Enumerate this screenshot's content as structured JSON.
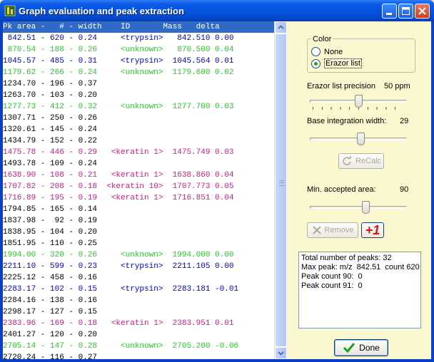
{
  "window": {
    "title": "Graph evaluation and peak extraction"
  },
  "list": {
    "header": "Pk area -   # - width    ID       Mass   delta",
    "rows": [
      {
        "text": " 842.51 - 620 - 0.24     <trypsin>   842.510 0.00",
        "color": "#0000cc"
      },
      {
        "text": " 870.54 - 188 - 0.26     <unknown>   870.500 0.04",
        "color": "#22cc22"
      },
      {
        "text": "1045.57 - 485 - 0.31     <trypsin>  1045.564 0.01",
        "color": "#0000cc"
      },
      {
        "text": "1179.62 - 266 - 0.24     <unknown>  1179.600 0.02",
        "color": "#22cc22"
      },
      {
        "text": "1234.70 - 196 - 0.37",
        "color": "#000000"
      },
      {
        "text": "1263.70 - 103 - 0.20",
        "color": "#000000"
      },
      {
        "text": "1277.73 - 412 - 0.32     <unknown>  1277.700 0.03",
        "color": "#22cc22"
      },
      {
        "text": "1307.71 - 250 - 0.26",
        "color": "#000000"
      },
      {
        "text": "1320.61 - 145 - 0.24",
        "color": "#000000"
      },
      {
        "text": "1434.79 - 152 - 0.22",
        "color": "#000000"
      },
      {
        "text": "1475.78 - 446 - 0.29   <keratin 1>  1475.749 0.03",
        "color": "#cc1a8c"
      },
      {
        "text": "1493.78 - 109 - 0.24",
        "color": "#000000"
      },
      {
        "text": "1638.90 - 108 - 0.21   <keratin 1>  1638.860 0.04",
        "color": "#cc1a8c"
      },
      {
        "text": "1707.82 - 208 - 0.18  <keratin 10>  1707.773 0.05",
        "color": "#cc1a8c"
      },
      {
        "text": "1716.89 - 195 - 0.19   <keratin 1>  1716.851 0.04",
        "color": "#cc1a8c"
      },
      {
        "text": "1794.85 - 165 - 0.14",
        "color": "#000000"
      },
      {
        "text": "1837.98 -  92 - 0.19",
        "color": "#000000"
      },
      {
        "text": "1838.95 - 104 - 0.20",
        "color": "#000000"
      },
      {
        "text": "1851.95 - 110 - 0.25",
        "color": "#000000"
      },
      {
        "text": "1994.00 - 320 - 0.26     <unknown>  1994.000 0.00",
        "color": "#22cc22"
      },
      {
        "text": "2211.10 - 599 - 0.23     <trypsin>  2211.105 0.00",
        "color": "#0000cc"
      },
      {
        "text": "2225.12 - 458 - 0.16",
        "color": "#000000"
      },
      {
        "text": "2283.17 - 102 - 0.15     <trypsin>  2283.181 -0.01",
        "color": "#0000cc"
      },
      {
        "text": "2284.16 - 138 - 0.16",
        "color": "#000000"
      },
      {
        "text": "2298.17 - 127 - 0.15",
        "color": "#000000"
      },
      {
        "text": "2383.96 - 169 - 0.18   <keratin 1>  2383.951 0.01",
        "color": "#cc1a8c"
      },
      {
        "text": "2401.27 - 120 - 0.20",
        "color": "#000000"
      },
      {
        "text": "2705.14 - 147 - 0.28     <unknown>  2705.200 -0.06",
        "color": "#22cc22"
      },
      {
        "text": "2720.24 - 116 - 0.27",
        "color": "#000000"
      }
    ]
  },
  "panel": {
    "color_group_label": "Color",
    "radio_none": "None",
    "radio_erazor": "Erazor list",
    "selected": "Erazor list",
    "precision_label": "Erazor list precision",
    "precision_value": "50 ppm",
    "precision_level": 0.5,
    "base_width_label": "Base integration width:",
    "base_width_value": "29",
    "base_width_level": 0.53,
    "recalc_label": "ReCalc",
    "min_area_label": "Min. accepted area:",
    "min_area_value": "90",
    "min_area_level": 0.58,
    "remove_label": "Remove",
    "plus_label": "+1",
    "stats": [
      "Total number of peaks: 32",
      "Max peak: m/z  842.51  count 620",
      "Peak count 90:  0",
      "Peak count 91:  0"
    ],
    "done_label": "Done"
  },
  "icons": {
    "app": "app-icon",
    "minimize": "minimize-icon",
    "maximize": "maximize-icon",
    "close": "close-icon",
    "recalc": "refresh-icon",
    "remove": "x-icon",
    "done": "checkmark-icon"
  },
  "colors": {
    "trypsin": "#0000cc",
    "unknown": "#22cc22",
    "keratin": "#cc1a8c",
    "unmatched": "#000000",
    "selection": "#316ac5",
    "panel_bg": "#fbf8cf"
  }
}
